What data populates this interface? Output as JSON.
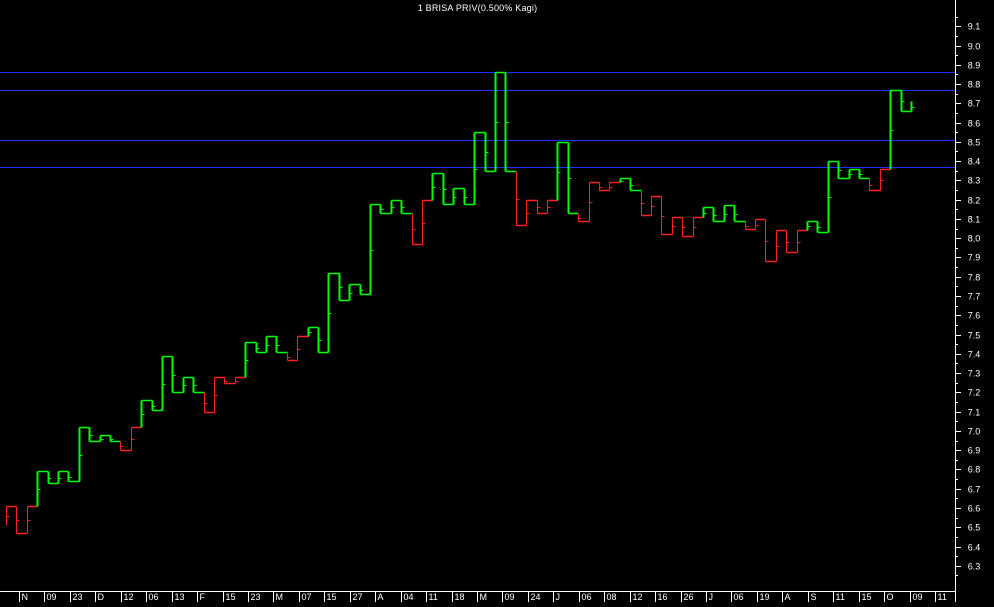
{
  "title": "1 BRISA PRIV(0.500% Kagi)",
  "colors": {
    "background": "#000000",
    "axis": "#ffffff",
    "up_line": "#00ff00",
    "down_line": "#ff2020",
    "horizontal_lines": "#1e32ff"
  },
  "chart_data": {
    "type": "line",
    "chart_style": "Kagi",
    "title": "1 BRISA PRIV(0.500% Kagi)",
    "y_axis_position": "right",
    "ylim": [
      6.2,
      9.2
    ],
    "y_ticks": [
      "6.3",
      "6.4",
      "6.5",
      "6.6",
      "6.7",
      "6.8",
      "6.9",
      "7.0",
      "7.1",
      "7.2",
      "7.3",
      "7.4",
      "7.5",
      "7.6",
      "7.7",
      "7.8",
      "7.9",
      "8.0",
      "8.1",
      "8.2",
      "8.3",
      "8.4",
      "8.5",
      "8.6",
      "8.7",
      "8.8",
      "8.9",
      "9.0",
      "9.1"
    ],
    "x_labels": [
      "N",
      "09",
      "23",
      "D",
      "12",
      "06",
      "13",
      "F",
      "15",
      "23",
      "M",
      "07",
      "15",
      "27",
      "A",
      "04",
      "11",
      "18",
      "M",
      "09",
      "24",
      "J",
      "06",
      "08",
      "12",
      "16",
      "26",
      "J",
      "06",
      "19",
      "A",
      "S",
      "11",
      "15",
      "O",
      "09",
      "11"
    ],
    "horizontal_lines": [
      8.86,
      8.77,
      8.51,
      8.37
    ],
    "kagi_verticals": [
      6.51,
      6.61,
      6.47,
      6.79,
      6.73,
      6.79,
      6.74,
      7.02,
      6.95,
      6.98,
      6.9,
      7.16,
      7.11,
      7.39,
      7.2,
      7.28,
      7.1,
      7.28,
      7.25,
      7.46,
      7.41,
      7.49,
      7.37,
      7.54,
      7.41,
      7.82,
      7.68,
      7.76,
      7.71,
      8.18,
      8.13,
      8.2,
      7.97,
      8.34,
      8.18,
      8.26,
      8.18,
      8.55,
      8.35,
      8.86,
      8.07,
      8.2,
      8.13,
      8.5,
      8.09,
      8.29,
      8.25,
      8.31,
      8.12,
      8.22,
      8.02,
      8.11,
      8.01,
      8.16,
      8.09,
      8.17,
      8.05,
      8.1,
      7.88,
      8.04,
      7.93,
      8.09,
      8.03,
      8.4,
      8.31,
      8.36,
      8.25,
      8.77,
      8.66,
      8.71
    ],
    "kagi_segments": [
      {
        "from": 6.51,
        "to": 6.61,
        "color": "down"
      },
      {
        "from": 6.61,
        "to": 6.47,
        "color": "down"
      },
      {
        "from": 6.47,
        "to": 6.61,
        "color": "down"
      },
      {
        "from": 6.61,
        "to": 6.79,
        "color": "up"
      },
      {
        "from": 6.79,
        "to": 6.73,
        "color": "up"
      },
      {
        "from": 6.73,
        "to": 6.79,
        "color": "up"
      },
      {
        "from": 6.79,
        "to": 6.74,
        "color": "up"
      },
      {
        "from": 6.74,
        "to": 7.02,
        "color": "up"
      },
      {
        "from": 7.02,
        "to": 6.95,
        "color": "up"
      },
      {
        "from": 6.95,
        "to": 6.98,
        "color": "up"
      },
      {
        "from": 6.98,
        "to": 6.95,
        "color": "up"
      },
      {
        "from": 6.95,
        "to": 6.9,
        "color": "down"
      },
      {
        "from": 6.9,
        "to": 7.02,
        "color": "down"
      },
      {
        "from": 7.02,
        "to": 7.16,
        "color": "up"
      },
      {
        "from": 7.16,
        "to": 7.11,
        "color": "up"
      },
      {
        "from": 7.11,
        "to": 7.39,
        "color": "up"
      },
      {
        "from": 7.39,
        "to": 7.2,
        "color": "up"
      },
      {
        "from": 7.2,
        "to": 7.28,
        "color": "up"
      },
      {
        "from": 7.28,
        "to": 7.2,
        "color": "up"
      },
      {
        "from": 7.2,
        "to": 7.1,
        "color": "down"
      },
      {
        "from": 7.1,
        "to": 7.28,
        "color": "down"
      },
      {
        "from": 7.28,
        "to": 7.25,
        "color": "down"
      },
      {
        "from": 7.25,
        "to": 7.28,
        "color": "down"
      },
      {
        "from": 7.28,
        "to": 7.46,
        "color": "up"
      },
      {
        "from": 7.46,
        "to": 7.41,
        "color": "up"
      },
      {
        "from": 7.41,
        "to": 7.49,
        "color": "up"
      },
      {
        "from": 7.49,
        "to": 7.41,
        "color": "up"
      },
      {
        "from": 7.41,
        "to": 7.37,
        "color": "down"
      },
      {
        "from": 7.37,
        "to": 7.49,
        "color": "down"
      },
      {
        "from": 7.49,
        "to": 7.54,
        "color": "up"
      },
      {
        "from": 7.54,
        "to": 7.41,
        "color": "up"
      },
      {
        "from": 7.41,
        "to": 7.82,
        "color": "up"
      },
      {
        "from": 7.82,
        "to": 7.68,
        "color": "up"
      },
      {
        "from": 7.68,
        "to": 7.76,
        "color": "up"
      },
      {
        "from": 7.76,
        "to": 7.71,
        "color": "up"
      },
      {
        "from": 7.71,
        "to": 8.18,
        "color": "up"
      },
      {
        "from": 8.18,
        "to": 8.13,
        "color": "up"
      },
      {
        "from": 8.13,
        "to": 8.2,
        "color": "up"
      },
      {
        "from": 8.2,
        "to": 8.13,
        "color": "up"
      },
      {
        "from": 8.13,
        "to": 7.97,
        "color": "down"
      },
      {
        "from": 7.97,
        "to": 8.2,
        "color": "down"
      },
      {
        "from": 8.2,
        "to": 8.34,
        "color": "up"
      },
      {
        "from": 8.34,
        "to": 8.18,
        "color": "up"
      },
      {
        "from": 8.18,
        "to": 8.26,
        "color": "up"
      },
      {
        "from": 8.26,
        "to": 8.18,
        "color": "up"
      },
      {
        "from": 8.18,
        "to": 8.55,
        "color": "up"
      },
      {
        "from": 8.55,
        "to": 8.35,
        "color": "up"
      },
      {
        "from": 8.35,
        "to": 8.86,
        "color": "up"
      },
      {
        "from": 8.86,
        "to": 8.35,
        "color": "up"
      },
      {
        "from": 8.35,
        "to": 8.07,
        "color": "down"
      },
      {
        "from": 8.07,
        "to": 8.2,
        "color": "down"
      },
      {
        "from": 8.2,
        "to": 8.13,
        "color": "down"
      },
      {
        "from": 8.13,
        "to": 8.2,
        "color": "down"
      },
      {
        "from": 8.2,
        "to": 8.5,
        "color": "up"
      },
      {
        "from": 8.5,
        "to": 8.13,
        "color": "up"
      },
      {
        "from": 8.13,
        "to": 8.09,
        "color": "down"
      },
      {
        "from": 8.09,
        "to": 8.29,
        "color": "down"
      },
      {
        "from": 8.29,
        "to": 8.25,
        "color": "down"
      },
      {
        "from": 8.25,
        "to": 8.29,
        "color": "down"
      },
      {
        "from": 8.29,
        "to": 8.31,
        "color": "up"
      },
      {
        "from": 8.31,
        "to": 8.25,
        "color": "up"
      },
      {
        "from": 8.25,
        "to": 8.12,
        "color": "down"
      },
      {
        "from": 8.12,
        "to": 8.22,
        "color": "down"
      },
      {
        "from": 8.22,
        "to": 8.02,
        "color": "down"
      },
      {
        "from": 8.02,
        "to": 8.11,
        "color": "down"
      },
      {
        "from": 8.11,
        "to": 8.01,
        "color": "down"
      },
      {
        "from": 8.01,
        "to": 8.11,
        "color": "down"
      },
      {
        "from": 8.11,
        "to": 8.16,
        "color": "up"
      },
      {
        "from": 8.16,
        "to": 8.09,
        "color": "up"
      },
      {
        "from": 8.09,
        "to": 8.17,
        "color": "up"
      },
      {
        "from": 8.17,
        "to": 8.09,
        "color": "up"
      },
      {
        "from": 8.09,
        "to": 8.05,
        "color": "down"
      },
      {
        "from": 8.05,
        "to": 8.1,
        "color": "down"
      },
      {
        "from": 8.1,
        "to": 7.88,
        "color": "down"
      },
      {
        "from": 7.88,
        "to": 8.04,
        "color": "down"
      },
      {
        "from": 8.04,
        "to": 7.93,
        "color": "down"
      },
      {
        "from": 7.93,
        "to": 8.04,
        "color": "down"
      },
      {
        "from": 8.04,
        "to": 8.09,
        "color": "up"
      },
      {
        "from": 8.09,
        "to": 8.03,
        "color": "up"
      },
      {
        "from": 8.03,
        "to": 8.4,
        "color": "up"
      },
      {
        "from": 8.4,
        "to": 8.31,
        "color": "up"
      },
      {
        "from": 8.31,
        "to": 8.36,
        "color": "up"
      },
      {
        "from": 8.36,
        "to": 8.31,
        "color": "up"
      },
      {
        "from": 8.31,
        "to": 8.25,
        "color": "down"
      },
      {
        "from": 8.25,
        "to": 8.36,
        "color": "down"
      },
      {
        "from": 8.36,
        "to": 8.77,
        "color": "up"
      },
      {
        "from": 8.77,
        "to": 8.66,
        "color": "up"
      },
      {
        "from": 8.66,
        "to": 8.71,
        "color": "up"
      }
    ]
  }
}
